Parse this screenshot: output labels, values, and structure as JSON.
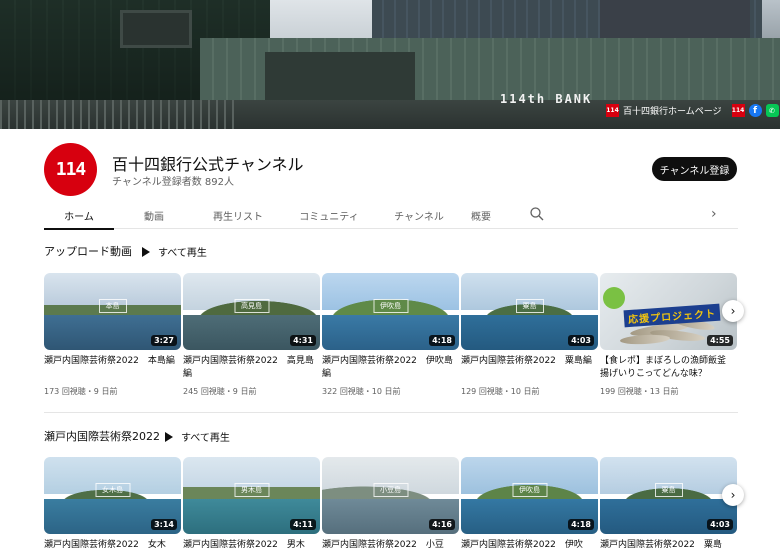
{
  "banner": {
    "bank_sign": "114th BANK",
    "logo_badge": "114",
    "homepage_link": "百十四銀行ホームページ",
    "social": [
      "114",
      "f",
      "LINE"
    ]
  },
  "channel": {
    "avatar_text": "114",
    "name": "百十四銀行公式チャンネル",
    "subscribers": "チャンネル登録者数 892人",
    "subscribe_label": "チャンネル登録"
  },
  "tabs": [
    {
      "label": "ホーム"
    },
    {
      "label": "動画"
    },
    {
      "label": "再生リスト"
    },
    {
      "label": "コミュニティ"
    },
    {
      "label": "チャンネル"
    },
    {
      "label": "概要"
    }
  ],
  "colors": {
    "brand": "#d7000f",
    "text": "#0f0f0f",
    "muted": "#606060"
  },
  "sections": [
    {
      "title": "アップロード動画",
      "play_all": "すべて再生",
      "videos": [
        {
          "title": "瀬戸内国際芸術祭2022　本島編",
          "meta": "173 回視聴・9 日前",
          "duration": "3:27",
          "thumb_label": "本島"
        },
        {
          "title": "瀬戸内国際芸術祭2022　高見島編",
          "meta": "245 回視聴・9 日前",
          "duration": "4:31",
          "thumb_label": "高見島"
        },
        {
          "title": "瀬戸内国際芸術祭2022　伊吹島編",
          "meta": "322 回視聴・10 日前",
          "duration": "4:18",
          "thumb_label": "伊吹島"
        },
        {
          "title": "瀬戸内国際芸術祭2022　粟島編",
          "meta": "129 回視聴・10 日前",
          "duration": "4:03",
          "thumb_label": "粟島"
        },
        {
          "title": "【食レポ】まぼろしの漁師飯釜揚げいりこってどんな味？",
          "meta": "199 回視聴・13 日前",
          "duration": "4:55",
          "thumb_label": "応援プロジェクト"
        }
      ]
    },
    {
      "title": "瀬戸内国際芸術祭2022",
      "play_all": "すべて再生",
      "videos": [
        {
          "title": "瀬戸内国際芸術祭2022　女木",
          "duration": "3:14",
          "thumb_label": "女木島"
        },
        {
          "title": "瀬戸内国際芸術祭2022　男木",
          "duration": "4:11",
          "thumb_label": "男木島"
        },
        {
          "title": "瀬戸内国際芸術祭2022　小豆",
          "duration": "4:16",
          "thumb_label": "小豆島"
        },
        {
          "title": "瀬戸内国際芸術祭2022　伊吹",
          "duration": "4:18",
          "thumb_label": "伊吹島"
        },
        {
          "title": "瀬戸内国際芸術祭2022　粟島",
          "duration": "4:03",
          "thumb_label": "粟島"
        }
      ]
    }
  ]
}
